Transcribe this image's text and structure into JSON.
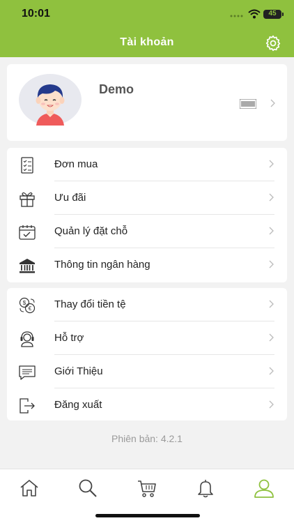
{
  "status_bar": {
    "time": "10:01",
    "battery": "45"
  },
  "header": {
    "title": "Tài khoản"
  },
  "profile": {
    "name": "Demo"
  },
  "menu_group_1": [
    {
      "label": "Đơn mua",
      "icon": "order-list-icon"
    },
    {
      "label": "Ưu đãi",
      "icon": "gift-icon"
    },
    {
      "label": "Quản lý đặt chỗ",
      "icon": "calendar-check-icon"
    },
    {
      "label": "Thông tin ngân hàng",
      "icon": "bank-icon"
    }
  ],
  "menu_group_2": [
    {
      "label": "Thay đổi tiền tệ",
      "icon": "currency-exchange-icon"
    },
    {
      "label": "Hỗ trợ",
      "icon": "support-headset-icon"
    },
    {
      "label": "Giới Thiệu",
      "icon": "info-message-icon"
    },
    {
      "label": "Đăng xuất",
      "icon": "logout-icon"
    }
  ],
  "version": "Phiên bản: 4.2.1",
  "nav": [
    "home-icon",
    "search-icon",
    "cart-icon",
    "bell-icon",
    "profile-icon"
  ],
  "colors": {
    "accent": "#8fc13e",
    "background": "#f2f2f2"
  }
}
